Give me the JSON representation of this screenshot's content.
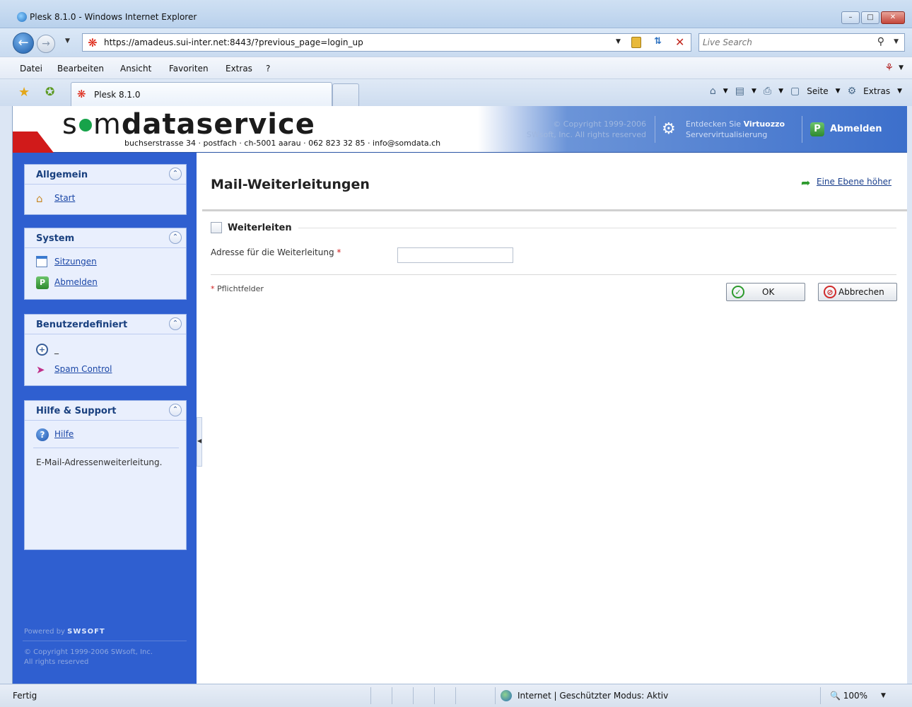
{
  "window": {
    "title": "Plesk 8.1.0 - Windows Internet Explorer"
  },
  "address_bar": {
    "url": "https://amadeus.sui-inter.net:8443/?previous_page=login_up"
  },
  "search": {
    "placeholder": "Live Search"
  },
  "menu": [
    "Datei",
    "Bearbeiten",
    "Ansicht",
    "Favoriten",
    "Extras",
    "?"
  ],
  "tab": {
    "label": "Plesk 8.1.0"
  },
  "command_bar": {
    "page_label": "Seite",
    "tools_label": "Extras"
  },
  "header": {
    "logo_part1": "s",
    "logo_part2": "m",
    "logo_bold": "dataservice",
    "address": "buchserstrasse 34 · postfach · ch-5001 aarau · 062 823 32 85 · info@somdata.ch",
    "copyright_line1": "© Copyright 1999-2006",
    "copyright_line2": "SWsoft, Inc. All rights reserved",
    "virtuozzo_line1_prefix": "Entdecken Sie ",
    "virtuozzo_line1_bold": "Virtuozzo",
    "virtuozzo_line2": "Servervirtualisierung",
    "logout_label": "Abmelden"
  },
  "sidebar": {
    "panels": [
      {
        "title": "Allgemein",
        "items": [
          {
            "label": "Start",
            "icon": "home-icon"
          }
        ]
      },
      {
        "title": "System",
        "items": [
          {
            "label": "Sitzungen",
            "icon": "sessions-icon"
          },
          {
            "label": "Abmelden",
            "icon": "logout-icon"
          }
        ]
      },
      {
        "title": "Benutzerdefiniert",
        "items": [
          {
            "label": "_",
            "icon": "custom-button-icon"
          },
          {
            "label": "Spam Control",
            "icon": "spam-control-icon"
          }
        ]
      },
      {
        "title": "Hilfe & Support",
        "items": [
          {
            "label": "Hilfe",
            "icon": "help-icon"
          }
        ],
        "description": "E-Mail-Adressenweiterleitung."
      }
    ],
    "powered_by_prefix": "Powered by",
    "powered_by_brand": "SWSOFT",
    "copyright_line1": "© Copyright 1999-2006 SWsoft, Inc.",
    "copyright_line2": "All rights reserved"
  },
  "main": {
    "title": "Mail-Weiterleitungen",
    "up_link": "Eine Ebene höher",
    "fieldset_legend": "Weiterleiten",
    "forward_enabled": false,
    "address_label": "Adresse für die Weiterleitung",
    "required_mark": "*",
    "address_value": "",
    "required_note": "Pflichtfelder",
    "ok_label": "OK",
    "cancel_label": "Abbrechen"
  },
  "statusbar": {
    "status": "Fertig",
    "zone": "Internet | Geschützter Modus: Aktiv",
    "zoom": "100%"
  }
}
